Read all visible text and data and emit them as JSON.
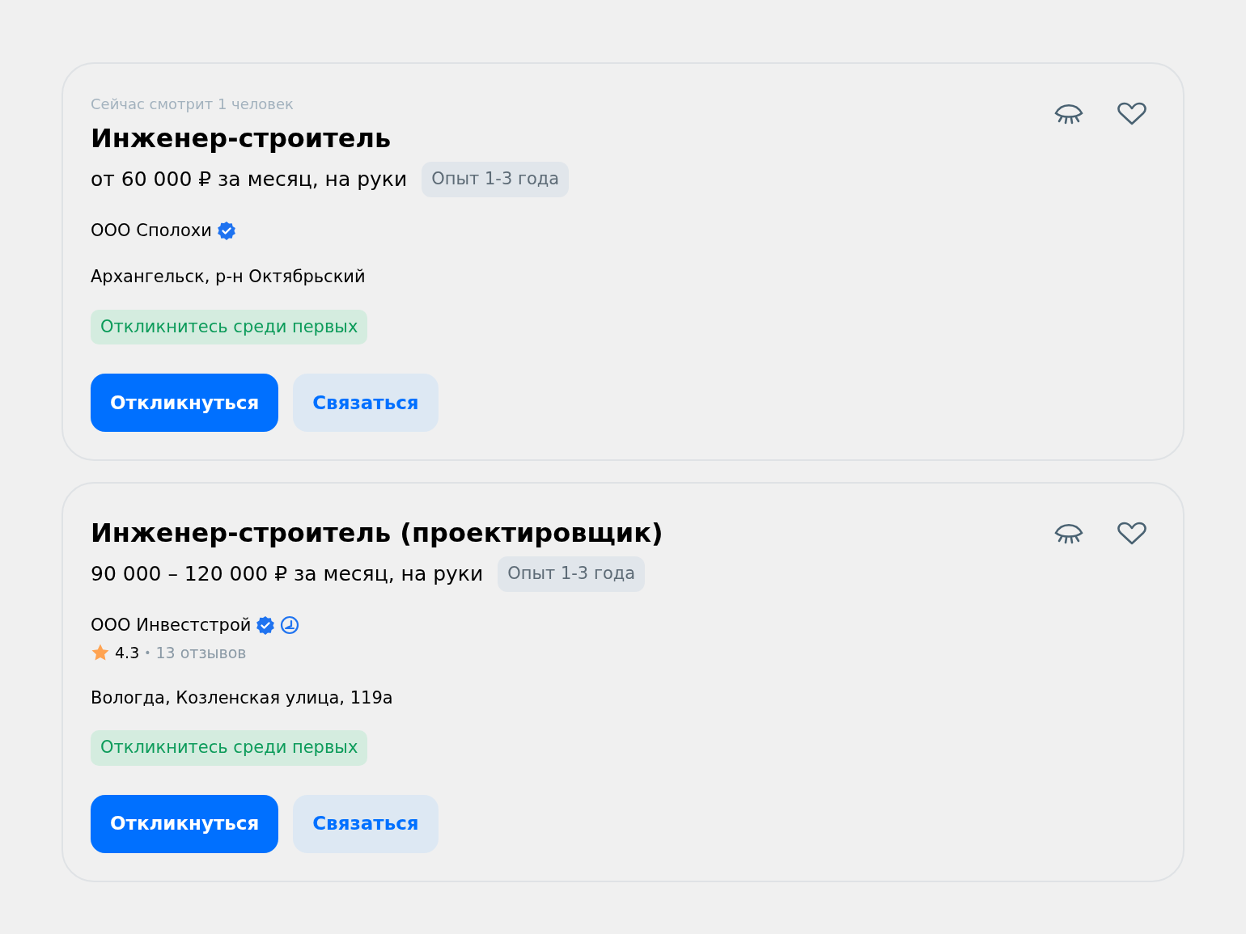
{
  "vacancies": [
    {
      "viewers": "Сейчас смотрит 1 человек",
      "title": "Инженер-строитель",
      "salary": "от 60 000 ₽ за месяц, на руки",
      "experience": "Опыт 1-3 года",
      "company": "ООО Сполохи",
      "verified": true,
      "address": "Архангельск, р-н Октябрьский",
      "tag": "Откликнитесь среди первых",
      "buttons": [
        {
          "label": "Откликнуться",
          "kind": "primary"
        },
        {
          "label": "Связаться",
          "kind": "secondary"
        }
      ]
    },
    {
      "title": "Инженер-строитель (проектировщик)",
      "salary": "90 000 – 120 000 ₽ за месяц, на руки",
      "experience": "Опыт 1-3 года",
      "company": "ООО Инвестстрой",
      "verified": true,
      "employer_badge": true,
      "rating": {
        "score": "4.3",
        "separator": "•",
        "reviews": "13 отзывов"
      },
      "address": "Вологда, Козленская улица, 119а",
      "tag": "Откликнитесь среди первых",
      "buttons": [
        {
          "label": "Откликнуться",
          "kind": "primary"
        },
        {
          "label": "Связаться",
          "kind": "secondary"
        }
      ]
    }
  ]
}
